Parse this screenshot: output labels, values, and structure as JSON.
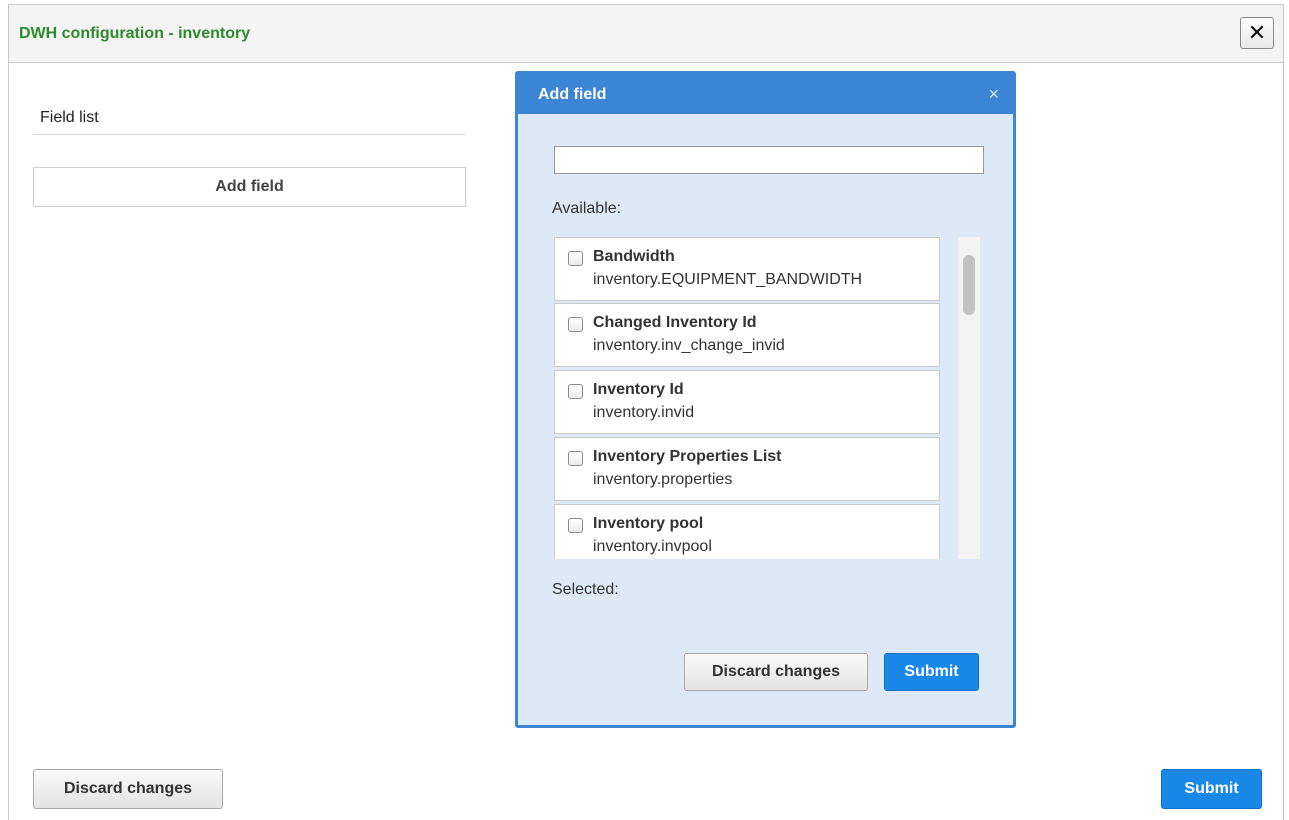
{
  "window": {
    "title": "DWH configuration - inventory",
    "close_glyph": "✕"
  },
  "main": {
    "field_list_label": "Field list",
    "add_field_button": "Add field",
    "discard_button": "Discard changes",
    "submit_button": "Submit"
  },
  "modal": {
    "title": "Add field",
    "close_glyph": "×",
    "search_value": "",
    "available_label": "Available:",
    "selected_label": "Selected:",
    "items": [
      {
        "label": "Bandwidth",
        "path": "inventory.EQUIPMENT_BANDWIDTH"
      },
      {
        "label": "Changed Inventory Id",
        "path": "inventory.inv_change_invid"
      },
      {
        "label": "Inventory Id",
        "path": "inventory.invid"
      },
      {
        "label": "Inventory Properties List",
        "path": "inventory.properties"
      },
      {
        "label": "Inventory pool",
        "path": "inventory.invpool"
      }
    ],
    "discard_button": "Discard changes",
    "submit_button": "Submit"
  },
  "colors": {
    "title_green": "#2d8a2d",
    "modal_blue": "#3c84d4",
    "submit_blue": "#1a88e6",
    "modal_bg": "#dde9f6"
  }
}
